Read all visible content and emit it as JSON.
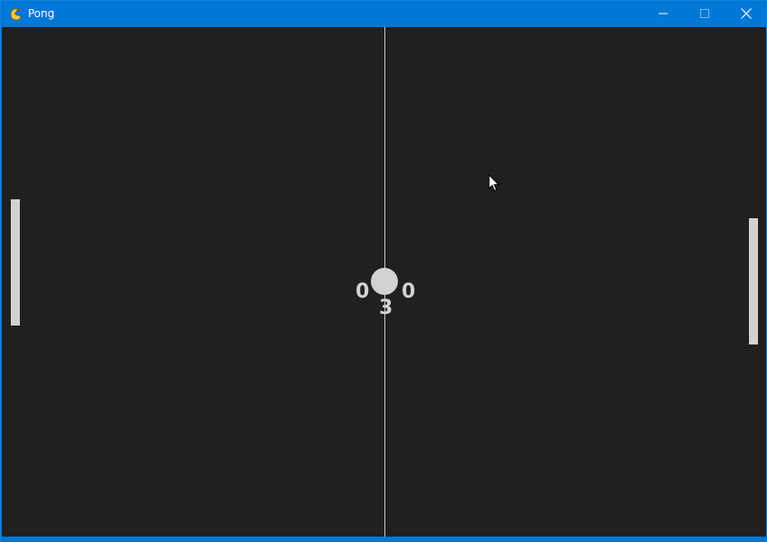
{
  "window": {
    "title": "Pong",
    "app_icon": "pygame-snake-icon",
    "controls": {
      "minimize": "minimize-icon",
      "maximize": "maximize-icon",
      "close": "close-icon"
    }
  },
  "game": {
    "scores": {
      "left": "0",
      "right": "0"
    },
    "countdown": "3"
  },
  "colors": {
    "titlebar": "#0078d7",
    "background": "#202020",
    "foreground": "#d2d2d2"
  }
}
